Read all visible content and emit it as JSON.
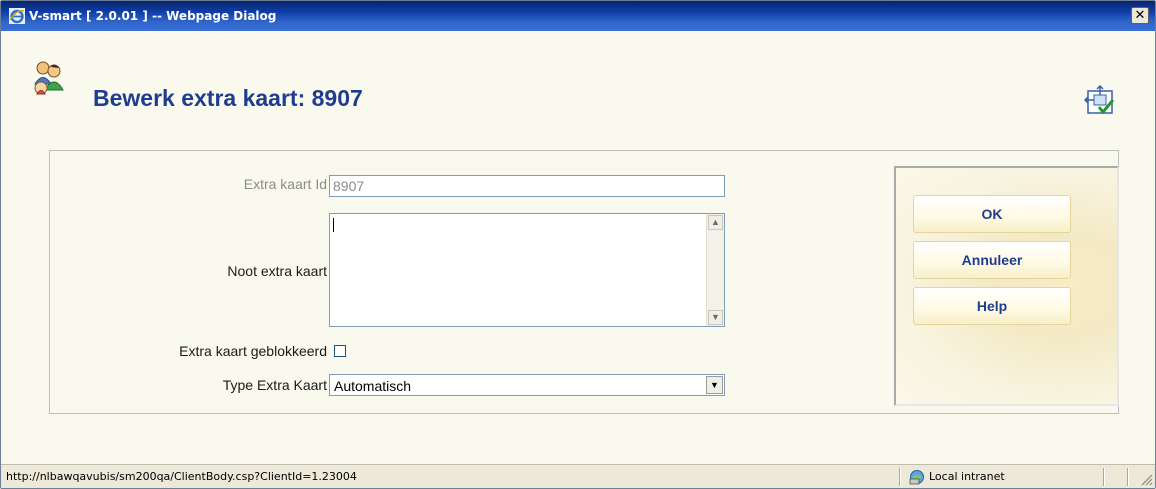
{
  "window": {
    "title": "V-smart [ 2.0.01 ] -- Webpage Dialog",
    "close_glyph": "✕"
  },
  "page": {
    "title": "Bewerk extra kaart: 8907",
    "title_icon": "users-icon",
    "validate_icon": "validate-form-icon"
  },
  "form": {
    "id_label": "Extra kaart Id",
    "id_value": "8907",
    "note_label": "Noot extra kaart",
    "note_value": "",
    "blocked_label": "Extra kaart geblokkeerd",
    "blocked_checked": false,
    "type_label": "Type Extra Kaart",
    "type_value": "Automatisch"
  },
  "actions": {
    "ok_label": "OK",
    "cancel_label": "Annuleer",
    "help_label": "Help"
  },
  "statusbar": {
    "url": "http://nlbawqavubis/sm200qa/ClientBody.csp?ClientId=1.23004",
    "zone": "Local intranet"
  },
  "colors": {
    "title_text": "#1f3d8f",
    "titlebar": "#0e3da6",
    "background": "#faf9ed"
  }
}
